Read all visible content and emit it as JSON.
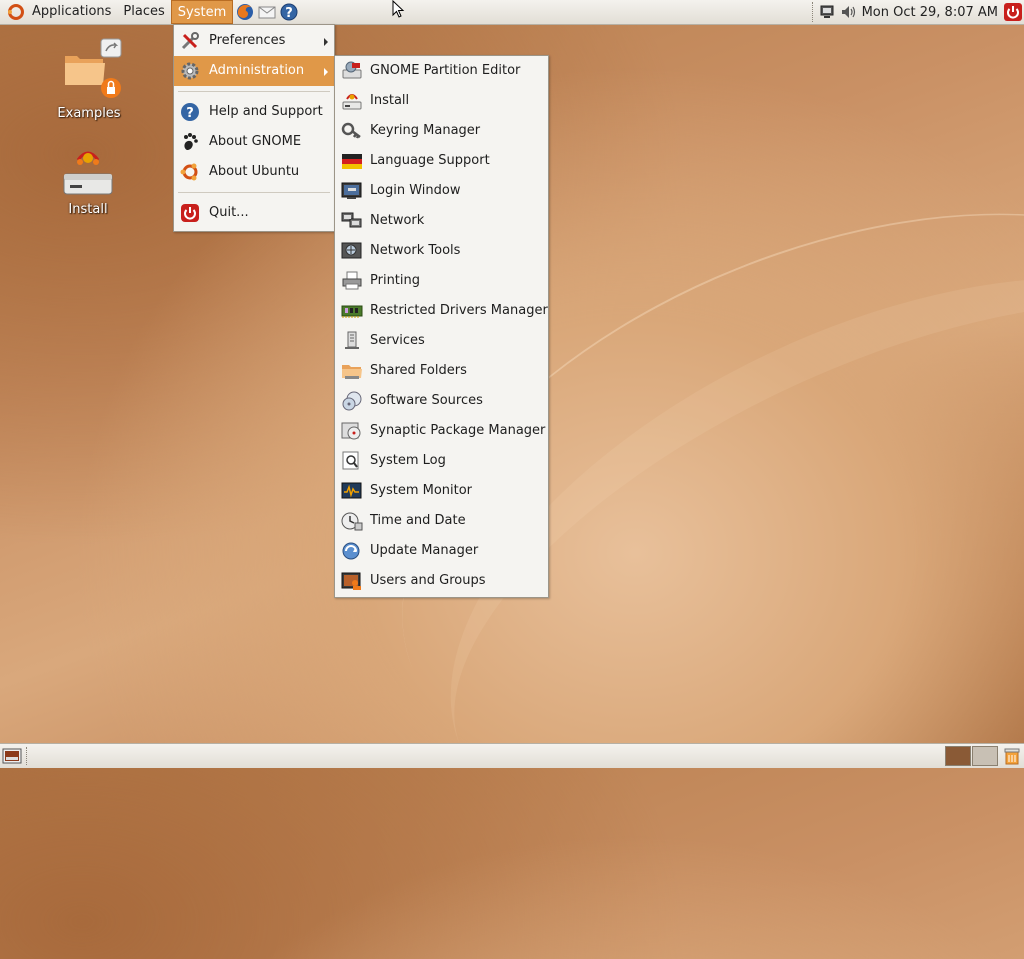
{
  "top_panel": {
    "menus": {
      "applications": "Applications",
      "places": "Places",
      "system": "System"
    },
    "launchers": [
      "firefox-icon",
      "mail-icon",
      "help-icon"
    ],
    "clock": "Mon Oct 29,  8:07 AM"
  },
  "desktop": {
    "icons": [
      {
        "label": "Examples",
        "icon": "folder-link-icon"
      },
      {
        "label": "Install",
        "icon": "install-drive-icon"
      }
    ]
  },
  "system_menu": {
    "items": [
      {
        "label": "Preferences",
        "icon": "preferences-icon",
        "submenu": true
      },
      {
        "label": "Administration",
        "icon": "administration-icon",
        "submenu": true,
        "selected": true
      },
      {
        "label": "Help and Support",
        "icon": "help-icon"
      },
      {
        "label": "About GNOME",
        "icon": "gnome-foot-icon"
      },
      {
        "label": "About Ubuntu",
        "icon": "ubuntu-icon"
      },
      {
        "label": "Quit...",
        "icon": "power-icon"
      }
    ]
  },
  "administration_menu": {
    "items": [
      {
        "label": "GNOME Partition Editor",
        "icon": "partition-editor-icon"
      },
      {
        "label": "Install",
        "icon": "install-icon"
      },
      {
        "label": "Keyring Manager",
        "icon": "keyring-icon"
      },
      {
        "label": "Language Support",
        "icon": "language-flag-icon"
      },
      {
        "label": "Login Window",
        "icon": "login-window-icon"
      },
      {
        "label": "Network",
        "icon": "network-icon"
      },
      {
        "label": "Network Tools",
        "icon": "network-tools-icon"
      },
      {
        "label": "Printing",
        "icon": "printer-icon"
      },
      {
        "label": "Restricted Drivers Manager",
        "icon": "driver-card-icon"
      },
      {
        "label": "Services",
        "icon": "services-icon"
      },
      {
        "label": "Shared Folders",
        "icon": "shared-folder-icon"
      },
      {
        "label": "Software Sources",
        "icon": "software-sources-icon"
      },
      {
        "label": "Synaptic Package Manager",
        "icon": "synaptic-icon"
      },
      {
        "label": "System Log",
        "icon": "system-log-icon"
      },
      {
        "label": "System Monitor",
        "icon": "system-monitor-icon"
      },
      {
        "label": "Time and Date",
        "icon": "clock-icon"
      },
      {
        "label": "Update Manager",
        "icon": "update-manager-icon"
      },
      {
        "label": "Users and Groups",
        "icon": "users-groups-icon"
      }
    ]
  },
  "colors": {
    "menu_highlight": "#e09848",
    "menu_bg": "#f5f4f1",
    "desktop_base": "#c99064"
  }
}
